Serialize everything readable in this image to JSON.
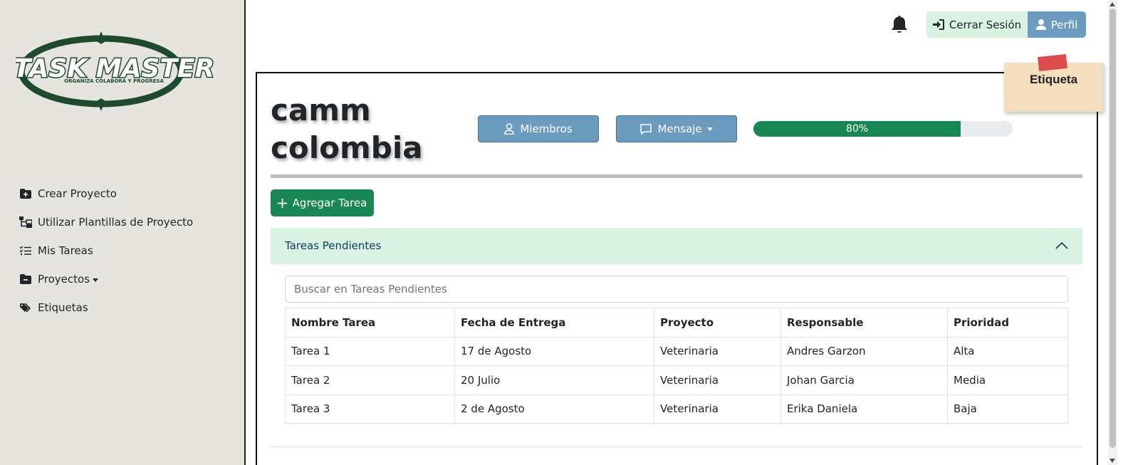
{
  "app": {
    "logo_text": "TASK MASTER",
    "logo_tagline": "ORGANIZA COLABORA Y PROGRESA"
  },
  "sidebar": {
    "items": [
      {
        "label": "Crear Proyecto",
        "icon": "folder-plus-icon"
      },
      {
        "label": "Utilizar Plantillas de Proyecto",
        "icon": "diagram-icon"
      },
      {
        "label": "Mis Tareas",
        "icon": "list-check-icon"
      },
      {
        "label": "Proyectos",
        "icon": "folder-minus-icon"
      },
      {
        "label": "Etiquetas",
        "icon": "tags-icon"
      }
    ]
  },
  "topbar": {
    "logout_label": "Cerrar Sesión",
    "profile_label": "Perfil"
  },
  "project": {
    "title_line1": "camm",
    "title_line2": "colombia",
    "members_label": "Miembros",
    "message_label": "Mensaje",
    "progress": 0.8,
    "progress_label": "80%",
    "sticky_label": "Etiqueta",
    "add_task_label": "Agregar Tarea"
  },
  "pending": {
    "header": "Tareas Pendientes",
    "search_placeholder": "Buscar en Tareas Pendientes",
    "columns": [
      "Nombre Tarea",
      "Fecha de Entrega",
      "Proyecto",
      "Responsable",
      "Prioridad"
    ],
    "rows": [
      [
        "Tarea 1",
        "17 de Agosto",
        "Veterinaria",
        "Andres Garzon",
        "Alta"
      ],
      [
        "Tarea 2",
        "20 Julio",
        "Veterinaria",
        "Johan Garcia",
        "Media"
      ],
      [
        "Tarea 3",
        "2 de Agosto",
        "Veterinaria",
        "Erika Daniela",
        "Baja"
      ]
    ]
  },
  "colors": {
    "sidebar_bg": "#e6e4de",
    "brand_green": "#1e4a2e",
    "success": "#198754",
    "steel_blue": "#6b9cbf",
    "mint": "#d9f2e2"
  }
}
